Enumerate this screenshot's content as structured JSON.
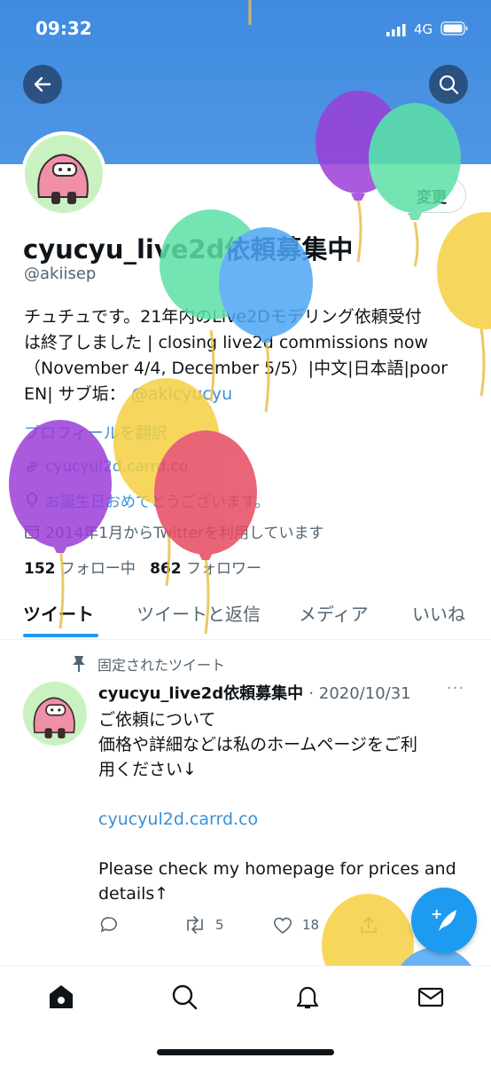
{
  "status_bar": {
    "time": "09:32",
    "network": "4G"
  },
  "header": {
    "back_label": "back",
    "search_label": "search"
  },
  "profile": {
    "edit_button": "変更",
    "display_name": "cyucyu_live2d依頼募集中",
    "handle": "@akiisep",
    "bio_lines": [
      "チュチュです。21年内のLive2Dモデリング依頼受付",
      "は終了しました | closing live2d commissions now",
      "（November 4/4, December 5/5）|中文|日本語|poor",
      "EN| サブ垢：",
      "@akicyucyu"
    ],
    "translate": "プロフィールを翻訳",
    "website": "cyucyul2d.carrd.co",
    "birthday": "お誕生日おめでとうございます。",
    "joined": "2014年1月からTwitterを利用しています",
    "following_count": "152",
    "following_label": "フォロー中",
    "followers_count": "862",
    "followers_label": "フォロワー"
  },
  "tabs": [
    "ツイート",
    "ツイートと返信",
    "メディア",
    "いいね"
  ],
  "pinned_tweet": {
    "pinned_label": "固定されたツイート",
    "author": "cyucyu_live2d依頼募集中",
    "date": "· 2020/10/31",
    "more": "···",
    "lines": [
      "ご依頼について",
      "価格や詳細などは私のホームページをご利",
      "用ください↓"
    ],
    "link": "cyucyul2d.carrd.co",
    "english_lines": [
      "Please check my homepage for prices and",
      "details↑"
    ],
    "retweets": "5",
    "likes": "18"
  },
  "fab_label": "+",
  "colors": {
    "accent": "#1d9bf0",
    "banner": "#4a92e2",
    "text": "#0f1419",
    "secondary": "#536471"
  }
}
